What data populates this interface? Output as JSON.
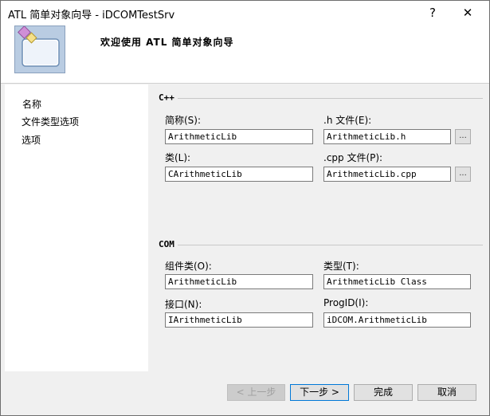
{
  "window": {
    "title": "ATL 简单对象向导 - iDCOMTestSrv",
    "help_glyph": "?",
    "close_glyph": "✕"
  },
  "header": {
    "title": "欢迎使用 ATL 简单对象向导",
    "icon": "wizard-icon"
  },
  "nav": {
    "items": [
      {
        "label": "名称"
      },
      {
        "label": "文件类型选项"
      },
      {
        "label": "选项"
      }
    ]
  },
  "cpp": {
    "title": "C++",
    "short_name_label": "简称(S):",
    "short_name_value": "ArithmeticLib",
    "h_file_label": ".h 文件(E):",
    "h_file_value": "ArithmeticLib.h",
    "class_label": "类(L):",
    "class_value": "CArithmeticLib",
    "cpp_file_label": ".cpp 文件(P):",
    "cpp_file_value": "ArithmeticLib.cpp",
    "browse_label": "..."
  },
  "com": {
    "title": "COM",
    "coclass_label": "组件类(O):",
    "coclass_value": "ArithmeticLib",
    "type_label": "类型(T):",
    "type_value": "ArithmeticLib Class",
    "interface_label": "接口(N):",
    "interface_value": "IArithmeticLib",
    "progid_label": "ProgID(I):",
    "progid_value": "iDCOM.ArithmeticLib"
  },
  "footer": {
    "prev_label": "< 上一步",
    "next_label": "下一步 >",
    "finish_label": "完成",
    "cancel_label": "取消"
  }
}
